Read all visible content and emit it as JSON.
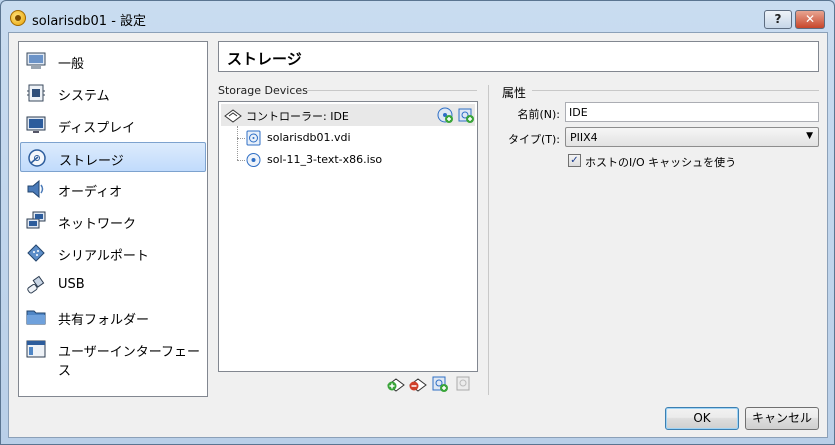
{
  "window": {
    "title": "solarisdb01 - 設定",
    "help_label": "?",
    "close_label": "✕"
  },
  "sidebar": {
    "items": [
      {
        "label": "一般",
        "icon": "general-icon"
      },
      {
        "label": "システム",
        "icon": "system-icon"
      },
      {
        "label": "ディスプレイ",
        "icon": "display-icon"
      },
      {
        "label": "ストレージ",
        "icon": "storage-icon",
        "selected": true
      },
      {
        "label": "オーディオ",
        "icon": "audio-icon"
      },
      {
        "label": "ネットワーク",
        "icon": "network-icon"
      },
      {
        "label": "シリアルポート",
        "icon": "serial-port-icon"
      },
      {
        "label": "USB",
        "icon": "usb-icon"
      },
      {
        "label": "共有フォルダー",
        "icon": "shared-folder-icon"
      },
      {
        "label": "ユーザーインターフェース",
        "icon": "user-interface-icon"
      }
    ]
  },
  "page": {
    "title": "ストレージ"
  },
  "storage": {
    "section_label": "Storage Devices",
    "controller": {
      "label": "コントローラー: IDE"
    },
    "attachments": [
      {
        "label": "solarisdb01.vdi",
        "icon": "hard-disk-icon"
      },
      {
        "label": "sol-11_3-text-x86.iso",
        "icon": "optical-disc-icon"
      }
    ]
  },
  "attributes": {
    "section_label": "属性",
    "name_label": "名前(N):",
    "name_value": "IDE",
    "type_label": "タイプ(T):",
    "type_value": "PIIX4",
    "cache_label": "ホストのI/O キャッシュを使う",
    "cache_checked": true
  },
  "buttons": {
    "ok": "OK",
    "cancel": "キャンセル"
  },
  "colors": {
    "selection": "#c1dbfc",
    "add_green": "#3aa53a",
    "accent_blue": "#2f6fc5"
  }
}
